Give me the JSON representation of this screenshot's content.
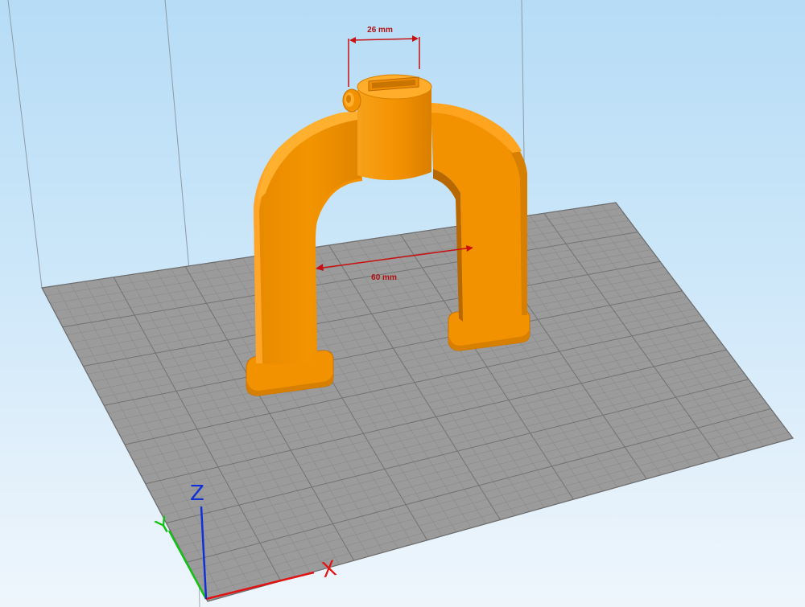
{
  "scene": {
    "measurements": {
      "top_width": "26 mm",
      "inner_span": "60 mm"
    },
    "axes": {
      "x": "X",
      "y": "Y",
      "z": "Z"
    },
    "colors": {
      "model": "#f39200",
      "model_shadow": "#d87d00",
      "model_light": "#ffab2e",
      "bed": "#9a9a9a",
      "bed_grid": "#7e7e7e",
      "dimension": "#c81010",
      "axis_x": "#e01414",
      "axis_y": "#12c212",
      "axis_z": "#1030d8"
    }
  }
}
